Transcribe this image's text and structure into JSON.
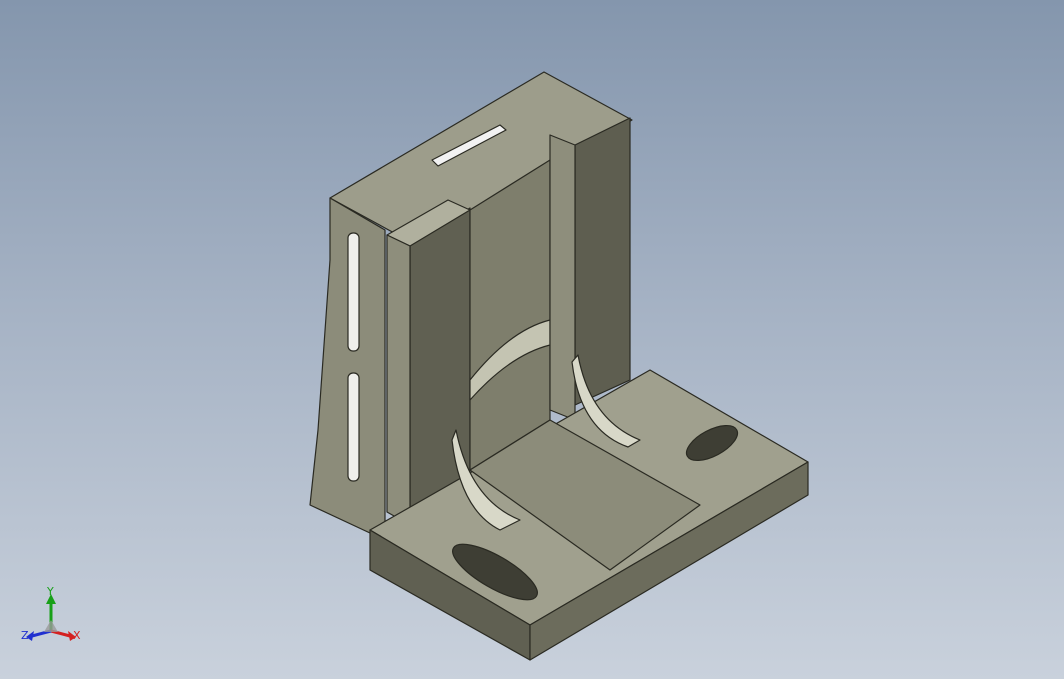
{
  "viewport": {
    "background": "gradient",
    "part_colors": {
      "face_light": "#a8a897",
      "face_mid": "#8a8a78",
      "face_dark": "#5c5c4e",
      "edge": "#2a2a22"
    }
  },
  "triad": {
    "x_label": "X",
    "y_label": "Y",
    "z_label": "Z",
    "x_color": "#d42020",
    "y_color": "#18a018",
    "z_color": "#2030d0"
  }
}
